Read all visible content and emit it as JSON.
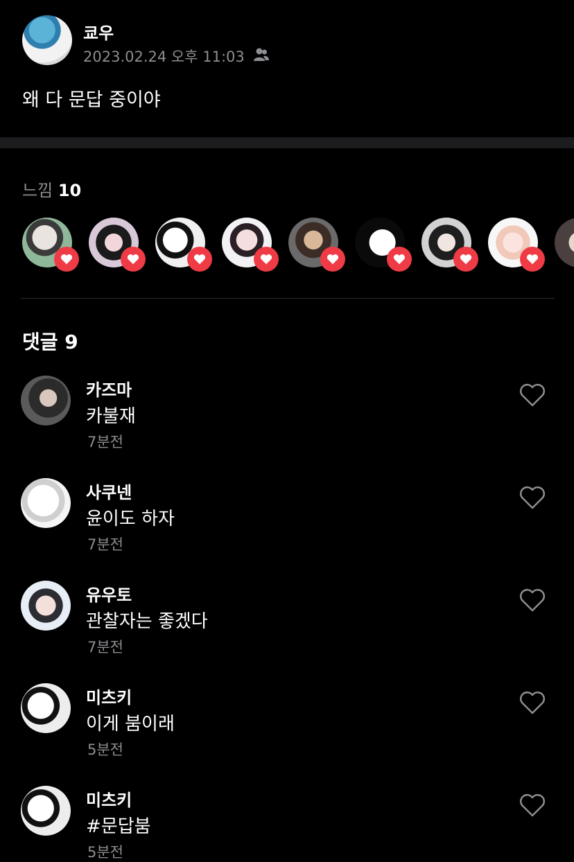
{
  "post": {
    "author": "쿄우",
    "timestamp": "2023.02.24 오후 11:03",
    "audience_icon": "people-icon",
    "text": "왜 다 문답 중이야"
  },
  "reactions": {
    "label": "느낌",
    "count": "10",
    "badge_icon": "heart-icon",
    "badge_color": "#ef3b45"
  },
  "comments_header": {
    "label": "댓글",
    "count": "9"
  },
  "comments": [
    {
      "name": "카즈마",
      "text": "카불재",
      "time": "7분전"
    },
    {
      "name": "사쿠넨",
      "text": "윤이도 하자",
      "time": "7분전"
    },
    {
      "name": "유우토",
      "text": "관찰자는 좋겠다",
      "time": "7분전"
    },
    {
      "name": "미츠키",
      "text": "이게 붐이래",
      "time": "5분전"
    },
    {
      "name": "미츠키",
      "text": "#문답붐",
      "time": "5분전"
    }
  ]
}
